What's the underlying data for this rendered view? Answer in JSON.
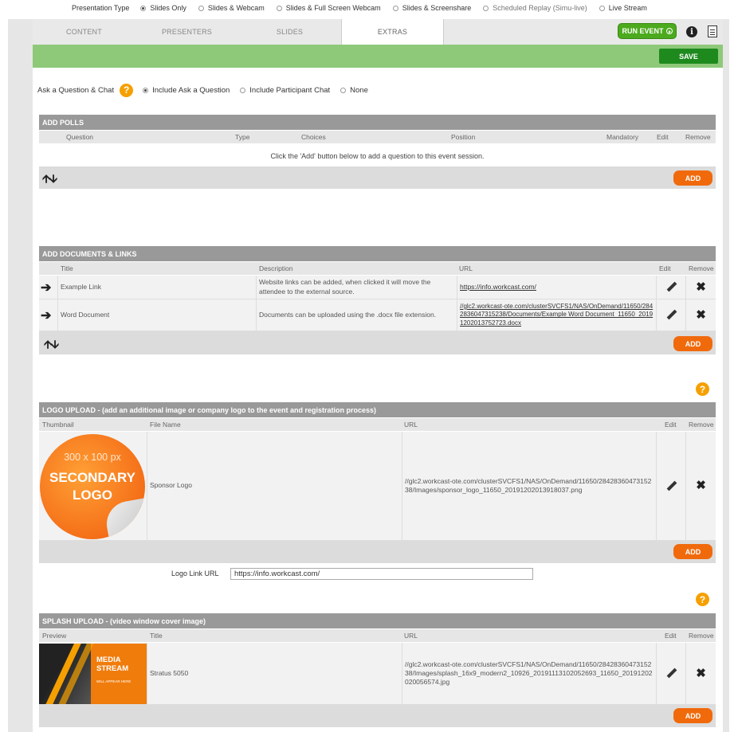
{
  "presentation_type": {
    "label": "Presentation Type",
    "options": [
      {
        "label": "Slides Only",
        "selected": true
      },
      {
        "label": "Slides & Webcam",
        "selected": false
      },
      {
        "label": "Slides & Full Screen Webcam",
        "selected": false
      },
      {
        "label": "Slides & Screenshare",
        "selected": false
      },
      {
        "label": "Scheduled Replay (Simu-live)",
        "selected": false
      },
      {
        "label": "Live Stream",
        "selected": false
      }
    ]
  },
  "tabs": [
    {
      "label": "CONTENT",
      "active": false
    },
    {
      "label": "PRESENTERS",
      "active": false
    },
    {
      "label": "SLIDES",
      "active": false
    },
    {
      "label": "EXTRAS",
      "active": true
    }
  ],
  "toolbar": {
    "run_event": "RUN EVENT",
    "save": "SAVE",
    "info_glyph": "i"
  },
  "ask": {
    "label": "Ask a Question & Chat",
    "help_glyph": "?",
    "options": [
      {
        "label": "Include Ask a Question",
        "selected": true
      },
      {
        "label": "Include Participant Chat",
        "selected": false
      },
      {
        "label": "None",
        "selected": false
      }
    ]
  },
  "polls": {
    "title": "ADD POLLS",
    "columns": [
      "Question",
      "Type",
      "Choices",
      "Position",
      "Mandatory",
      "Edit",
      "Remove"
    ],
    "empty_message": "Click the 'Add' button below to add a question to this event session.",
    "add": "ADD"
  },
  "documents": {
    "title": "ADD DOCUMENTS & LINKS",
    "columns": [
      "Title",
      "Description",
      "URL",
      "Edit",
      "Remove"
    ],
    "rows": [
      {
        "title": "Example Link",
        "description": "Website links can be added, when clicked it will move the attendee to the external source.",
        "url": "https://info.workcast.com/"
      },
      {
        "title": "Word Document",
        "description": "Documents can be uploaded using the .docx file extension.",
        "url": "//glc2.workcast-ote.com/clusterSVCFS1/NAS/OnDemand/11650/2842836047315238/Documents/Example Word Document_11650_20191202013752723.docx"
      }
    ],
    "add": "ADD"
  },
  "logo": {
    "title": "LOGO UPLOAD - (add an additional image or company logo to the event and registration process)",
    "columns": [
      "Thumbnail",
      "File Name",
      "URL",
      "Edit",
      "Remove"
    ],
    "thumb_text": [
      "300 x 100 px",
      "SECONDARY",
      "LOGO"
    ],
    "file_name": "Sponsor Logo",
    "url": "//glc2.workcast-ote.com/clusterSVCFS1/NAS/OnDemand/11650/2842836047315238/Images/sponsor_logo_11650_20191202013918037.png",
    "add": "ADD",
    "link_label": "Logo Link URL",
    "link_value": "https://info.workcast.com/",
    "help_glyph": "?"
  },
  "splash": {
    "title": "SPLASH UPLOAD - (video window cover image)",
    "columns": [
      "Preview",
      "Title",
      "URL",
      "Edit",
      "Remove"
    ],
    "thumb_text": [
      "MEDIA",
      "STREAM",
      "WILL APPEAR HERE"
    ],
    "file_title": "Stratus 5050",
    "url": "//glc2.workcast-ote.com/clusterSVCFS1/NAS/OnDemand/11650/2842836047315238/Images/splash_16x9_modern2_10926_20191113102052693_11650_20191202020056574.jpg",
    "add": "ADD",
    "help_glyph": "?"
  },
  "colors": {
    "accent_orange": "#f06a0c",
    "help_orange": "#f5a000",
    "run_green": "#4caa1e",
    "save_green": "#1e8a1e",
    "bar_green": "#8ec97a",
    "section_gray": "#999999"
  }
}
